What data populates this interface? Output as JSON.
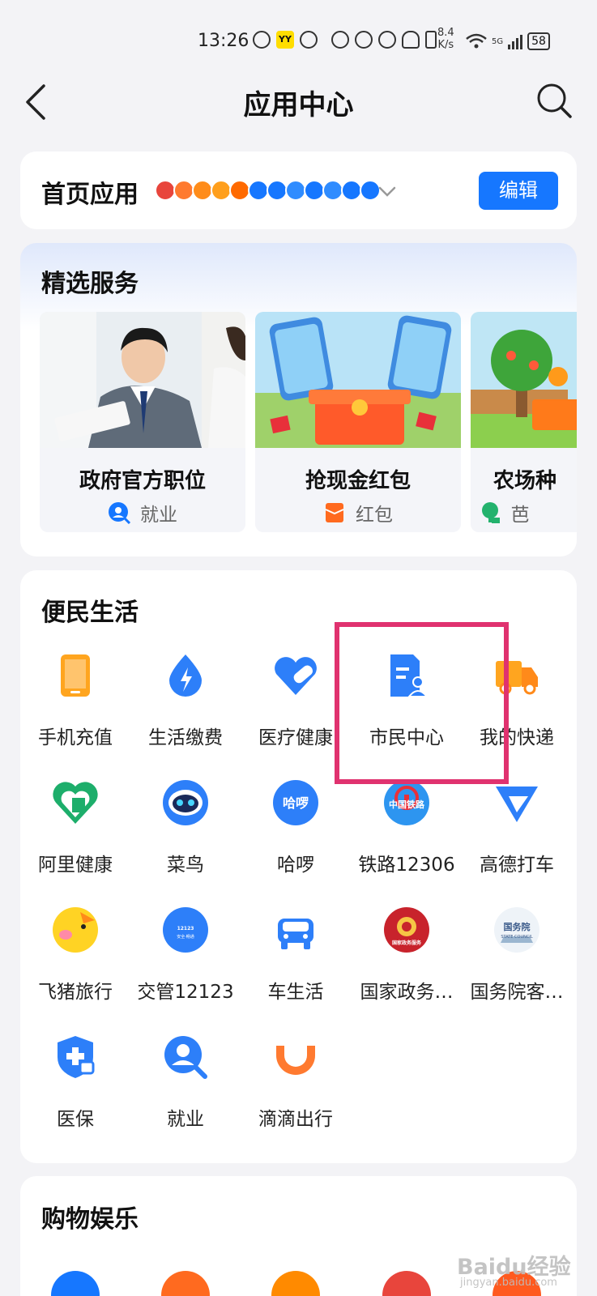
{
  "status_bar": {
    "time": "13:26",
    "yy_badge": "YY",
    "net_speed_value": "8.4",
    "net_speed_unit": "K/s",
    "network": "5G",
    "battery": "58"
  },
  "header": {
    "title": "应用中心",
    "back_icon": "chevron-left-icon",
    "search_icon": "search-icon"
  },
  "home_apps": {
    "label": "首页应用",
    "edit_label": "编辑",
    "mini_icon_colors": [
      "#e8453c",
      "#ff7a2f",
      "#ff8c1a",
      "#ff9f1c",
      "#ff6a00",
      "#1677ff",
      "#1677ff",
      "#2f8cff",
      "#1677ff",
      "#2f8cff",
      "#1677ff",
      "#1677ff"
    ]
  },
  "featured": {
    "title": "精选服务",
    "items": [
      {
        "title": "政府官方职位",
        "tag": "就业",
        "tag_icon": "job-search-icon",
        "tag_color": "#1677ff"
      },
      {
        "title": "抢现金红包",
        "tag": "红包",
        "tag_icon": "red-envelope-icon",
        "tag_color": "#ff6a1f"
      },
      {
        "title": "农场种",
        "tag": "芭",
        "tag_icon": "tree-icon",
        "tag_color": "#23b26d"
      }
    ]
  },
  "life": {
    "title": "便民生活",
    "apps": [
      {
        "label": "手机充值",
        "icon": "phone-recharge-icon"
      },
      {
        "label": "生活缴费",
        "icon": "bolt-drop-icon"
      },
      {
        "label": "医疗健康",
        "icon": "heart-bandage-icon"
      },
      {
        "label": "市民中心",
        "icon": "citizen-card-icon"
      },
      {
        "label": "我的快递",
        "icon": "delivery-truck-icon"
      },
      {
        "label": "阿里健康",
        "icon": "ali-health-icon"
      },
      {
        "label": "菜鸟",
        "icon": "cainiao-bird-icon"
      },
      {
        "label": "哈啰",
        "icon": "hello-logo-icon",
        "badge": "哈啰"
      },
      {
        "label": "铁路12306",
        "icon": "railway-logo-icon",
        "badge": "中国铁路"
      },
      {
        "label": "高德打车",
        "icon": "amap-taxi-icon"
      },
      {
        "label": "飞猪旅行",
        "icon": "fliggy-pig-icon"
      },
      {
        "label": "交管12123",
        "icon": "traffic-12123-icon",
        "badge": "12123",
        "badge_sub": "安全·畅通"
      },
      {
        "label": "车生活",
        "icon": "car-icon"
      },
      {
        "label": "国家政务…",
        "icon": "national-emblem-icon",
        "badge": "国家政务服务"
      },
      {
        "label": "国务院客…",
        "icon": "state-council-icon",
        "badge": "国务院",
        "badge_sub": "STATE COUNCIL"
      },
      {
        "label": "医保",
        "icon": "medical-insurance-icon"
      },
      {
        "label": "就业",
        "icon": "job-search-icon"
      },
      {
        "label": "滴滴出行",
        "icon": "didi-icon"
      }
    ]
  },
  "shopping": {
    "title": "购物娱乐",
    "icon_colors": [
      "#1677ff",
      "#ff6a1f",
      "#ff8a00",
      "#e8453c",
      "#ff5a1f"
    ]
  },
  "watermark": {
    "text": "Baidu经验",
    "sub": "jingyan.baidu.com"
  }
}
